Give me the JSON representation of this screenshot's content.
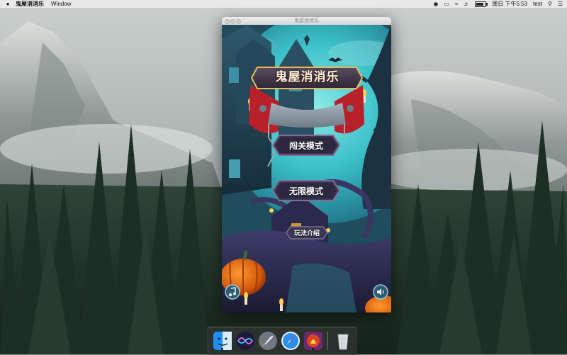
{
  "menubar": {
    "app_name": "鬼屋消消乐",
    "menus": [
      "Window"
    ],
    "clock": "周日 下午5:53",
    "user": "test"
  },
  "window": {
    "title": "鬼屋消消乐"
  },
  "game": {
    "title": "鬼屋消消乐",
    "buttons": {
      "levels": "闯关模式",
      "endless": "无限模式",
      "help": "玩法介绍"
    },
    "icons": {
      "music": "music-note-icon",
      "sound": "speaker-icon"
    }
  },
  "dock": {
    "items": [
      "finder",
      "siri",
      "launchpad",
      "safari",
      "haunted-house-game",
      "trash"
    ]
  },
  "colors": {
    "sky_teal": "#2fb6c4",
    "button_purple": "#3c3554",
    "sign_red": "#b8202a",
    "pumpkin": "#e06a14"
  }
}
